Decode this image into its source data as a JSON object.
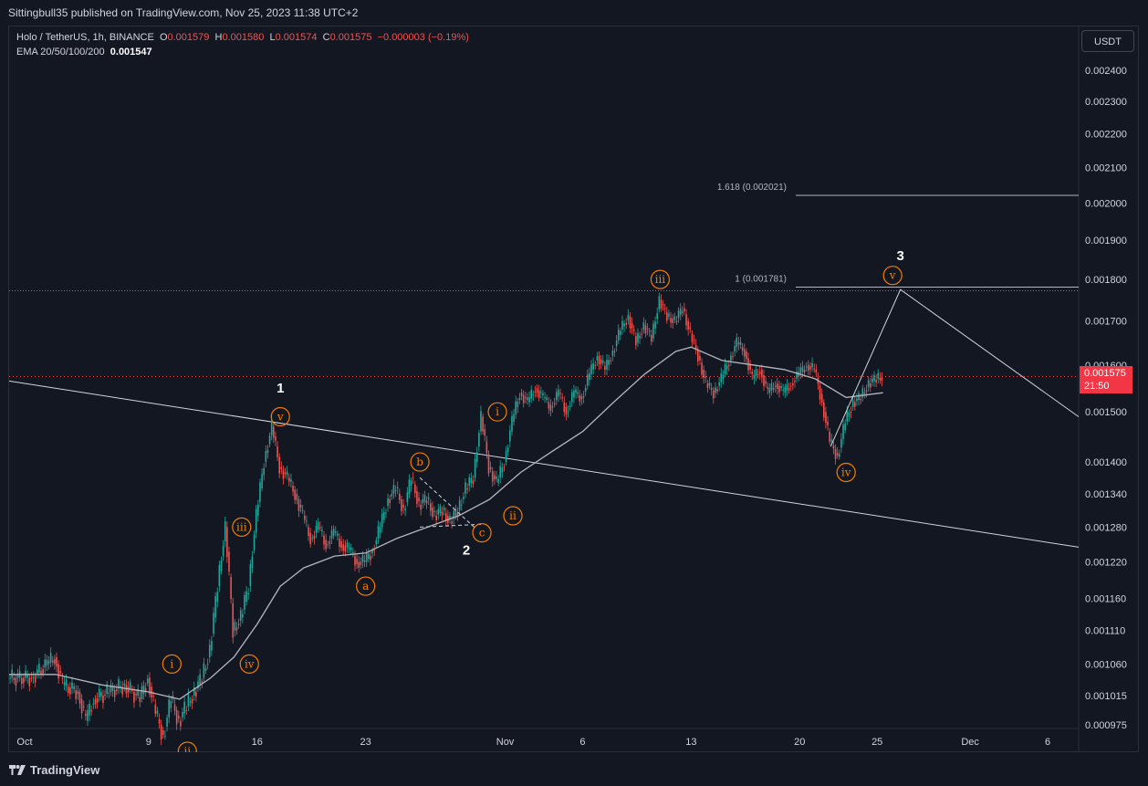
{
  "header": {
    "published": "Sittingbull35 published on TradingView.com, Nov 25, 2023 11:38 UTC+2"
  },
  "legend": {
    "symbol": "Holo / TetherUS, 1h, BINANCE",
    "o_label": "O",
    "o": "0.001579",
    "h_label": "H",
    "h": "0.001580",
    "l_label": "L",
    "l": "0.001574",
    "c_label": "C",
    "c": "0.001575",
    "change": "−0.000003 (−0.19%)",
    "ema_label": "EMA 20/50/100/200",
    "ema_value": "0.001547"
  },
  "currency_button": "USDT",
  "last_price": {
    "value": "0.001575",
    "countdown": "21:50"
  },
  "branding": "TradingView",
  "colors": {
    "up": "#26a69a",
    "down": "#ef5350",
    "wave": "#f57c00",
    "background": "#131722"
  },
  "chart_data": {
    "type": "line",
    "symbol": "Holo / TetherUS",
    "interval": "1h",
    "log_scale": true,
    "x_range": [
      "2023-09-30",
      "2023-12-08"
    ],
    "y_range": [
      0.00094,
      0.00255
    ],
    "x_tick_labels": [
      {
        "date": "2023-10-01",
        "label": "Oct"
      },
      {
        "date": "2023-10-09",
        "label": "9"
      },
      {
        "date": "2023-10-16",
        "label": "16"
      },
      {
        "date": "2023-10-23",
        "label": "23"
      },
      {
        "date": "2023-11-01",
        "label": "Nov"
      },
      {
        "date": "2023-11-06",
        "label": "6"
      },
      {
        "date": "2023-11-13",
        "label": "13"
      },
      {
        "date": "2023-11-20",
        "label": "20"
      },
      {
        "date": "2023-11-25",
        "label": "25"
      },
      {
        "date": "2023-12-01",
        "label": "Dec"
      },
      {
        "date": "2023-12-06",
        "label": "6"
      }
    ],
    "y_tick_labels": [
      "0.002400",
      "0.002300",
      "0.002200",
      "0.002100",
      "0.002000",
      "0.001900",
      "0.001800",
      "0.001700",
      "0.001600",
      "0.001500",
      "0.001400",
      "0.001340",
      "0.001280",
      "0.001220",
      "0.001160",
      "0.001110",
      "0.001060",
      "0.001015",
      "0.000975"
    ],
    "price_path": [
      [
        "2023-09-30T00:00",
        0.00104
      ],
      [
        "2023-10-01T12:00",
        0.00104
      ],
      [
        "2023-10-02T12:00",
        0.00106
      ],
      [
        "2023-10-03T00:00",
        0.00107
      ],
      [
        "2023-10-03T12:00",
        0.00103
      ],
      [
        "2023-10-04T12:00",
        0.00102
      ],
      [
        "2023-10-05T00:00",
        0.00098
      ],
      [
        "2023-10-05T12:00",
        0.00101
      ],
      [
        "2023-10-06T12:00",
        0.00102
      ],
      [
        "2023-10-07T12:00",
        0.00103
      ],
      [
        "2023-10-08T12:00",
        0.00101
      ],
      [
        "2023-10-09T00:00",
        0.00104
      ],
      [
        "2023-10-09T12:00",
        0.00099
      ],
      [
        "2023-10-10T00:00",
        0.00096
      ],
      [
        "2023-10-10T12:00",
        0.00101
      ],
      [
        "2023-10-11T00:00",
        0.00098
      ],
      [
        "2023-10-11T12:00",
        0.001
      ],
      [
        "2023-10-12T00:00",
        0.00102
      ],
      [
        "2023-10-12T12:00",
        0.00104
      ],
      [
        "2023-10-13T00:00",
        0.00108
      ],
      [
        "2023-10-13T12:00",
        0.00118
      ],
      [
        "2023-10-14T00:00",
        0.00128
      ],
      [
        "2023-10-14T12:00",
        0.00111
      ],
      [
        "2023-10-15T00:00",
        0.00113
      ],
      [
        "2023-10-15T12:00",
        0.00118
      ],
      [
        "2023-10-16T00:00",
        0.0013
      ],
      [
        "2023-10-16T12:00",
        0.0014
      ],
      [
        "2023-10-17T00:00",
        0.00147
      ],
      [
        "2023-10-17T12:00",
        0.00139
      ],
      [
        "2023-10-18T00:00",
        0.00137
      ],
      [
        "2023-10-18T12:00",
        0.00134
      ],
      [
        "2023-10-19T00:00",
        0.0013
      ],
      [
        "2023-10-19T12:00",
        0.00126
      ],
      [
        "2023-10-20T00:00",
        0.00128
      ],
      [
        "2023-10-20T12:00",
        0.00125
      ],
      [
        "2023-10-21T00:00",
        0.00127
      ],
      [
        "2023-10-21T12:00",
        0.00125
      ],
      [
        "2023-10-22T00:00",
        0.00124
      ],
      [
        "2023-10-22T12:00",
        0.00122
      ],
      [
        "2023-10-23T00:00",
        0.00122
      ],
      [
        "2023-10-23T12:00",
        0.00124
      ],
      [
        "2023-10-24T00:00",
        0.00128
      ],
      [
        "2023-10-24T12:00",
        0.00133
      ],
      [
        "2023-10-25T00:00",
        0.00135
      ],
      [
        "2023-10-25T12:00",
        0.00131
      ],
      [
        "2023-10-26T00:00",
        0.00137
      ],
      [
        "2023-10-26T12:00",
        0.00132
      ],
      [
        "2023-10-27T00:00",
        0.00133
      ],
      [
        "2023-10-27T12:00",
        0.0013
      ],
      [
        "2023-10-28T00:00",
        0.00131
      ],
      [
        "2023-10-28T12:00",
        0.00129
      ],
      [
        "2023-10-29T00:00",
        0.00131
      ],
      [
        "2023-10-29T12:00",
        0.00135
      ],
      [
        "2023-10-30T00:00",
        0.00137
      ],
      [
        "2023-10-30T12:00",
        0.00149
      ],
      [
        "2023-10-31T00:00",
        0.00139
      ],
      [
        "2023-10-31T12:00",
        0.00136
      ],
      [
        "2023-11-01T00:00",
        0.0014
      ],
      [
        "2023-11-01T12:00",
        0.00148
      ],
      [
        "2023-11-02T00:00",
        0.00154
      ],
      [
        "2023-11-02T12:00",
        0.00152
      ],
      [
        "2023-11-03T00:00",
        0.00155
      ],
      [
        "2023-11-03T12:00",
        0.00153
      ],
      [
        "2023-11-04T00:00",
        0.00151
      ],
      [
        "2023-11-04T12:00",
        0.00154
      ],
      [
        "2023-11-05T00:00",
        0.0015
      ],
      [
        "2023-11-05T12:00",
        0.00154
      ],
      [
        "2023-11-06T00:00",
        0.00153
      ],
      [
        "2023-11-06T12:00",
        0.00158
      ],
      [
        "2023-11-07T00:00",
        0.00162
      ],
      [
        "2023-11-07T12:00",
        0.00159
      ],
      [
        "2023-11-08T00:00",
        0.00163
      ],
      [
        "2023-11-08T12:00",
        0.00168
      ],
      [
        "2023-11-09T00:00",
        0.00171
      ],
      [
        "2023-11-09T12:00",
        0.00165
      ],
      [
        "2023-11-10T00:00",
        0.00169
      ],
      [
        "2023-11-10T12:00",
        0.00166
      ],
      [
        "2023-11-11T00:00",
        0.00175
      ],
      [
        "2023-11-11T12:00",
        0.00171
      ],
      [
        "2023-11-12T00:00",
        0.0017
      ],
      [
        "2023-11-12T12:00",
        0.00173
      ],
      [
        "2023-11-13T00:00",
        0.00167
      ],
      [
        "2023-11-13T12:00",
        0.00162
      ],
      [
        "2023-11-14T00:00",
        0.00156
      ],
      [
        "2023-11-14T12:00",
        0.00154
      ],
      [
        "2023-11-15T00:00",
        0.00157
      ],
      [
        "2023-11-15T12:00",
        0.00161
      ],
      [
        "2023-11-16T00:00",
        0.00165
      ],
      [
        "2023-11-16T12:00",
        0.00163
      ],
      [
        "2023-11-17T00:00",
        0.00157
      ],
      [
        "2023-11-17T12:00",
        0.00159
      ],
      [
        "2023-11-18T00:00",
        0.00154
      ],
      [
        "2023-11-18T12:00",
        0.00156
      ],
      [
        "2023-11-19T00:00",
        0.00154
      ],
      [
        "2023-11-19T12:00",
        0.00156
      ],
      [
        "2023-11-20T00:00",
        0.00158
      ],
      [
        "2023-11-20T12:00",
        0.0016
      ],
      [
        "2023-11-21T00:00",
        0.00159
      ],
      [
        "2023-11-21T12:00",
        0.00152
      ],
      [
        "2023-11-22T00:00",
        0.00144
      ],
      [
        "2023-11-22T12:00",
        0.00141
      ],
      [
        "2023-11-23T00:00",
        0.00148
      ],
      [
        "2023-11-23T12:00",
        0.00152
      ],
      [
        "2023-11-24T00:00",
        0.00153
      ],
      [
        "2023-11-24T12:00",
        0.00156
      ],
      [
        "2023-11-25T00:00",
        0.00157
      ],
      [
        "2023-11-25T09:00",
        0.001575
      ]
    ],
    "ema_path": [
      [
        "2023-09-30T00:00",
        0.001045
      ],
      [
        "2023-10-03T00:00",
        0.001045
      ],
      [
        "2023-10-06T00:00",
        0.00103
      ],
      [
        "2023-10-09T00:00",
        0.00102
      ],
      [
        "2023-10-11T00:00",
        0.00101
      ],
      [
        "2023-10-13T00:00",
        0.00104
      ],
      [
        "2023-10-14T12:00",
        0.00107
      ],
      [
        "2023-10-16T00:00",
        0.00112
      ],
      [
        "2023-10-17T12:00",
        0.00118
      ],
      [
        "2023-10-19T00:00",
        0.00121
      ],
      [
        "2023-10-21T00:00",
        0.00123
      ],
      [
        "2023-10-23T00:00",
        0.001235
      ],
      [
        "2023-10-25T00:00",
        0.00126
      ],
      [
        "2023-10-27T00:00",
        0.00128
      ],
      [
        "2023-10-29T00:00",
        0.0013
      ],
      [
        "2023-10-31T00:00",
        0.00133
      ],
      [
        "2023-11-02T00:00",
        0.00138
      ],
      [
        "2023-11-04T00:00",
        0.00142
      ],
      [
        "2023-11-06T00:00",
        0.00146
      ],
      [
        "2023-11-08T00:00",
        0.00152
      ],
      [
        "2023-11-10T00:00",
        0.00158
      ],
      [
        "2023-11-12T00:00",
        0.00163
      ],
      [
        "2023-11-13T00:00",
        0.00164
      ],
      [
        "2023-11-15T00:00",
        0.00161
      ],
      [
        "2023-11-17T00:00",
        0.0016
      ],
      [
        "2023-11-19T00:00",
        0.00159
      ],
      [
        "2023-11-21T00:00",
        0.00157
      ],
      [
        "2023-11-23T00:00",
        0.00153
      ],
      [
        "2023-11-25T09:00",
        0.00154
      ]
    ],
    "trendline": [
      [
        "2023-09-30T00:00",
        0.001565
      ],
      [
        "2023-12-08T00:00",
        0.001245
      ]
    ],
    "forecast_path": [
      [
        "2023-11-22T00:00",
        0.00143
      ],
      [
        "2023-11-26T12:00",
        0.001775
      ],
      [
        "2023-12-08T00:00",
        0.00149
      ]
    ],
    "correction_triangle": [
      [
        "2023-10-26T12:00",
        0.00137
      ],
      [
        "2023-10-30T00:00",
        0.00128
      ],
      [
        "2023-10-26T12:00",
        0.00128
      ]
    ],
    "fib_levels": [
      {
        "label": "1.618 (0.002021)",
        "price": 0.002021
      },
      {
        "label": "1 (0.001781)",
        "price": 0.001781
      }
    ],
    "current_price_line": 0.001575,
    "wave_labels": [
      {
        "text": "1",
        "date": "2023-10-17T12:00",
        "price": 0.00155,
        "style": "primary"
      },
      {
        "text": "2",
        "date": "2023-10-29T12:00",
        "price": 0.00124,
        "style": "primary"
      },
      {
        "text": "3",
        "date": "2023-11-26T12:00",
        "price": 0.00186,
        "style": "primary"
      },
      {
        "text": "i",
        "date": "2023-10-10T12:00",
        "price": 0.00106,
        "style": "minor"
      },
      {
        "text": "ii",
        "date": "2023-10-11T12:00",
        "price": 0.00094,
        "style": "minor"
      },
      {
        "text": "iii",
        "date": "2023-10-15T00:00",
        "price": 0.00128,
        "style": "minor"
      },
      {
        "text": "iv",
        "date": "2023-10-15T12:00",
        "price": 0.00106,
        "style": "minor"
      },
      {
        "text": "v",
        "date": "2023-10-17T12:00",
        "price": 0.00149,
        "style": "minor"
      },
      {
        "text": "a",
        "date": "2023-10-23T00:00",
        "price": 0.00118,
        "style": "minor"
      },
      {
        "text": "b",
        "date": "2023-10-26T12:00",
        "price": 0.0014,
        "style": "minor"
      },
      {
        "text": "c",
        "date": "2023-10-30T12:00",
        "price": 0.00127,
        "style": "minor"
      },
      {
        "text": "i",
        "date": "2023-10-31T12:00",
        "price": 0.0015,
        "style": "minor"
      },
      {
        "text": "ii",
        "date": "2023-11-01T12:00",
        "price": 0.0013,
        "style": "minor"
      },
      {
        "text": "iii",
        "date": "2023-11-11T00:00",
        "price": 0.0018,
        "style": "minor"
      },
      {
        "text": "iv",
        "date": "2023-11-23T00:00",
        "price": 0.00138,
        "style": "minor"
      },
      {
        "text": "v",
        "date": "2023-11-26T00:00",
        "price": 0.00181,
        "style": "minor"
      }
    ]
  }
}
